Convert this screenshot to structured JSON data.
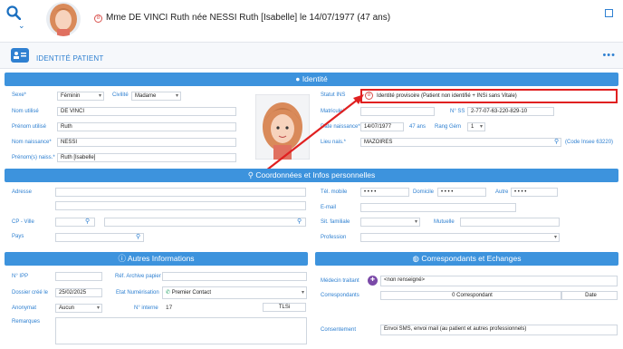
{
  "header": {
    "patient_title": "Mme DE VINCI Ruth née NESSI Ruth [Isabelle] le 14/07/1977 (47 ans)"
  },
  "section_header": {
    "title": "IDENTITÉ PATIENT"
  },
  "identite": {
    "band": "Identité",
    "sexe_label": "Sexe*",
    "sexe_value": "Féminin",
    "civilite_label": "Civilité",
    "civilite_value": "Madame",
    "nom_utilise_label": "Nom utilisé",
    "nom_utilise_value": "DE VINCI",
    "prenom_utilise_label": "Prénom utilisé",
    "prenom_utilise_value": "Ruth",
    "nom_naissance_label": "Nom naissance*",
    "nom_naissance_value": "NESSI",
    "prenoms_naiss_label": "Prénom(s) naiss.*",
    "prenoms_naiss_value": "Ruth [Isabelle]",
    "statut_ins_label": "Statut INS",
    "statut_ins_value": "Identité provisoire (Patient non identifié + INSi sans Vitale)",
    "matricule_label": "Matricule/",
    "ns_label": "N° SS",
    "ns_value": "2-77-07-63-220-829-10",
    "date_naissance_label": "Date naissance*",
    "date_naissance_value": "14/07/1977",
    "age_value": "47 ans",
    "rang_gem_label": "Rang Gém",
    "rang_gem_value": "1",
    "lieu_naiss_label": "Lieu nais.*",
    "lieu_naiss_value": "MAZOIRES",
    "code_insee": "(Code Insee 63220)"
  },
  "coordonnees": {
    "band": "Coordonnées et Infos personnelles",
    "adresse_label": "Adresse",
    "cp_ville_label": "CP - Ville",
    "pays_label": "Pays",
    "tel_mobile_label": "Tél. mobile",
    "tel_mobile_value": "• • • •",
    "domicile_label": "Domicile",
    "domicile_value": "• • • •",
    "autre_label": "Autre",
    "autre_value": "• • • •",
    "email_label": "E-mail",
    "sit_familiale_label": "Sit. familiale",
    "mutuelle_label": "Mutuelle",
    "profession_label": "Profession"
  },
  "autres": {
    "band": "Autres Informations",
    "ipp_label": "N° IPP",
    "ref_archive_label": "Réf. Archive papier",
    "dossier_cree_label": "Dossier créé le",
    "dossier_cree_value": "25/02/2025",
    "etat_num_label": "Etat Numérisation",
    "etat_num_value": "Premier Contact",
    "anonymat_label": "Anonymat",
    "anonymat_value": "Aucun",
    "n_interne_label": "N° interne",
    "n_interne_value": "17",
    "tlsi_button": "TLSi",
    "remarques_label": "Remarques"
  },
  "correspondants": {
    "band": "Correspondants et Echanges",
    "medecin_traitant_label": "Médecin traitant",
    "medecin_traitant_value": "<non renseigné>",
    "correspondants_label": "Correspondants",
    "correspondants_value": "0 Correspondant",
    "date_button": "Date",
    "consentement_label": "Consentement",
    "consentement_value": "Envoi SMS, envoi mail (au patient et autres professionnels)"
  }
}
